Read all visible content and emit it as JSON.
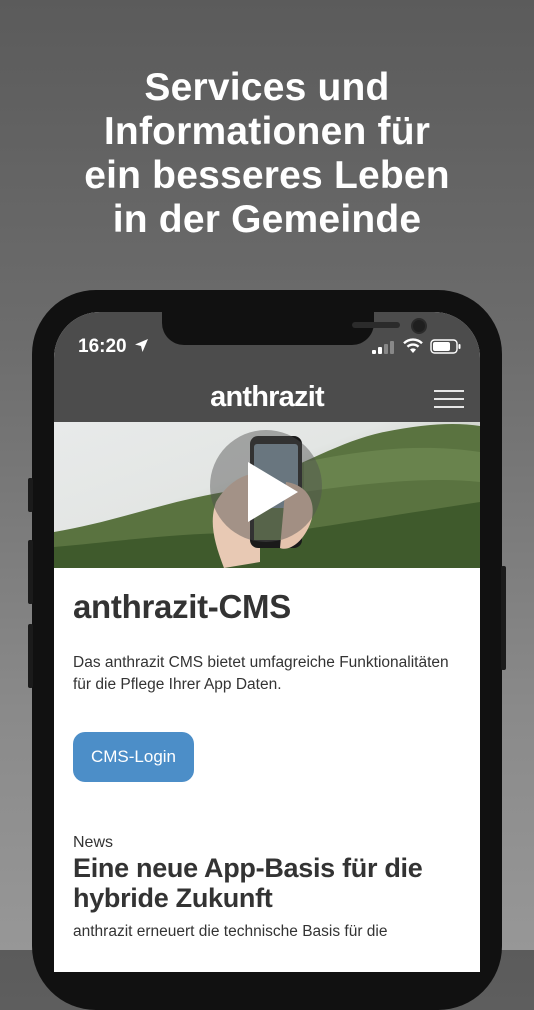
{
  "headline": [
    "Services und",
    "Informationen für",
    "ein besseres Leben",
    "in der Gemeinde"
  ],
  "status_bar": {
    "time": "16:20"
  },
  "app": {
    "logo": "anthrazit"
  },
  "cms": {
    "title": "anthrazit-CMS",
    "description": "Das anthrazit CMS bietet umfagreiche Funktionalitäten für die Pflege Ihrer App Daten.",
    "button_label": "CMS-Login"
  },
  "news": {
    "category": "News",
    "title": "Eine neue App-Basis für die hybride Zukunft",
    "teaser": "anthrazit erneuert die technische Basis für die"
  },
  "colors": {
    "accent_button": "#4c8ec8",
    "header_bg": "#4c4c4c"
  }
}
